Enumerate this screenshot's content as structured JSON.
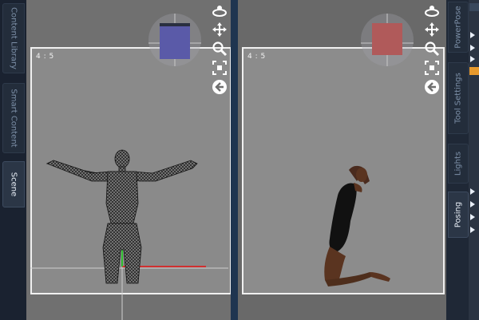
{
  "left_tabs": [
    {
      "label": "Content Library",
      "active": false
    },
    {
      "label": "Smart Content",
      "active": false
    },
    {
      "label": "Scene",
      "active": true
    }
  ],
  "right_tabs": [
    {
      "label": "PowerPose",
      "active": false
    },
    {
      "label": "Tool Settings",
      "active": false
    },
    {
      "label": "Lights",
      "active": false
    },
    {
      "label": "Posing",
      "active": true
    }
  ],
  "viewports": [
    {
      "aspect_label": "4 : 5",
      "cube_color": "#5a5aa8",
      "figure": "wireframe-figure"
    },
    {
      "aspect_label": "4 : 5",
      "cube_color": "#b05a5a",
      "figure": "posed-figure"
    }
  ],
  "nav_icons": [
    "orbit-icon",
    "pan-icon",
    "zoom-icon",
    "frame-icon",
    "reset-view-icon"
  ],
  "colors": {
    "accent_orange": "#e89a2c",
    "panel_bg": "#1d2633",
    "frame": "#f0f0f0"
  }
}
